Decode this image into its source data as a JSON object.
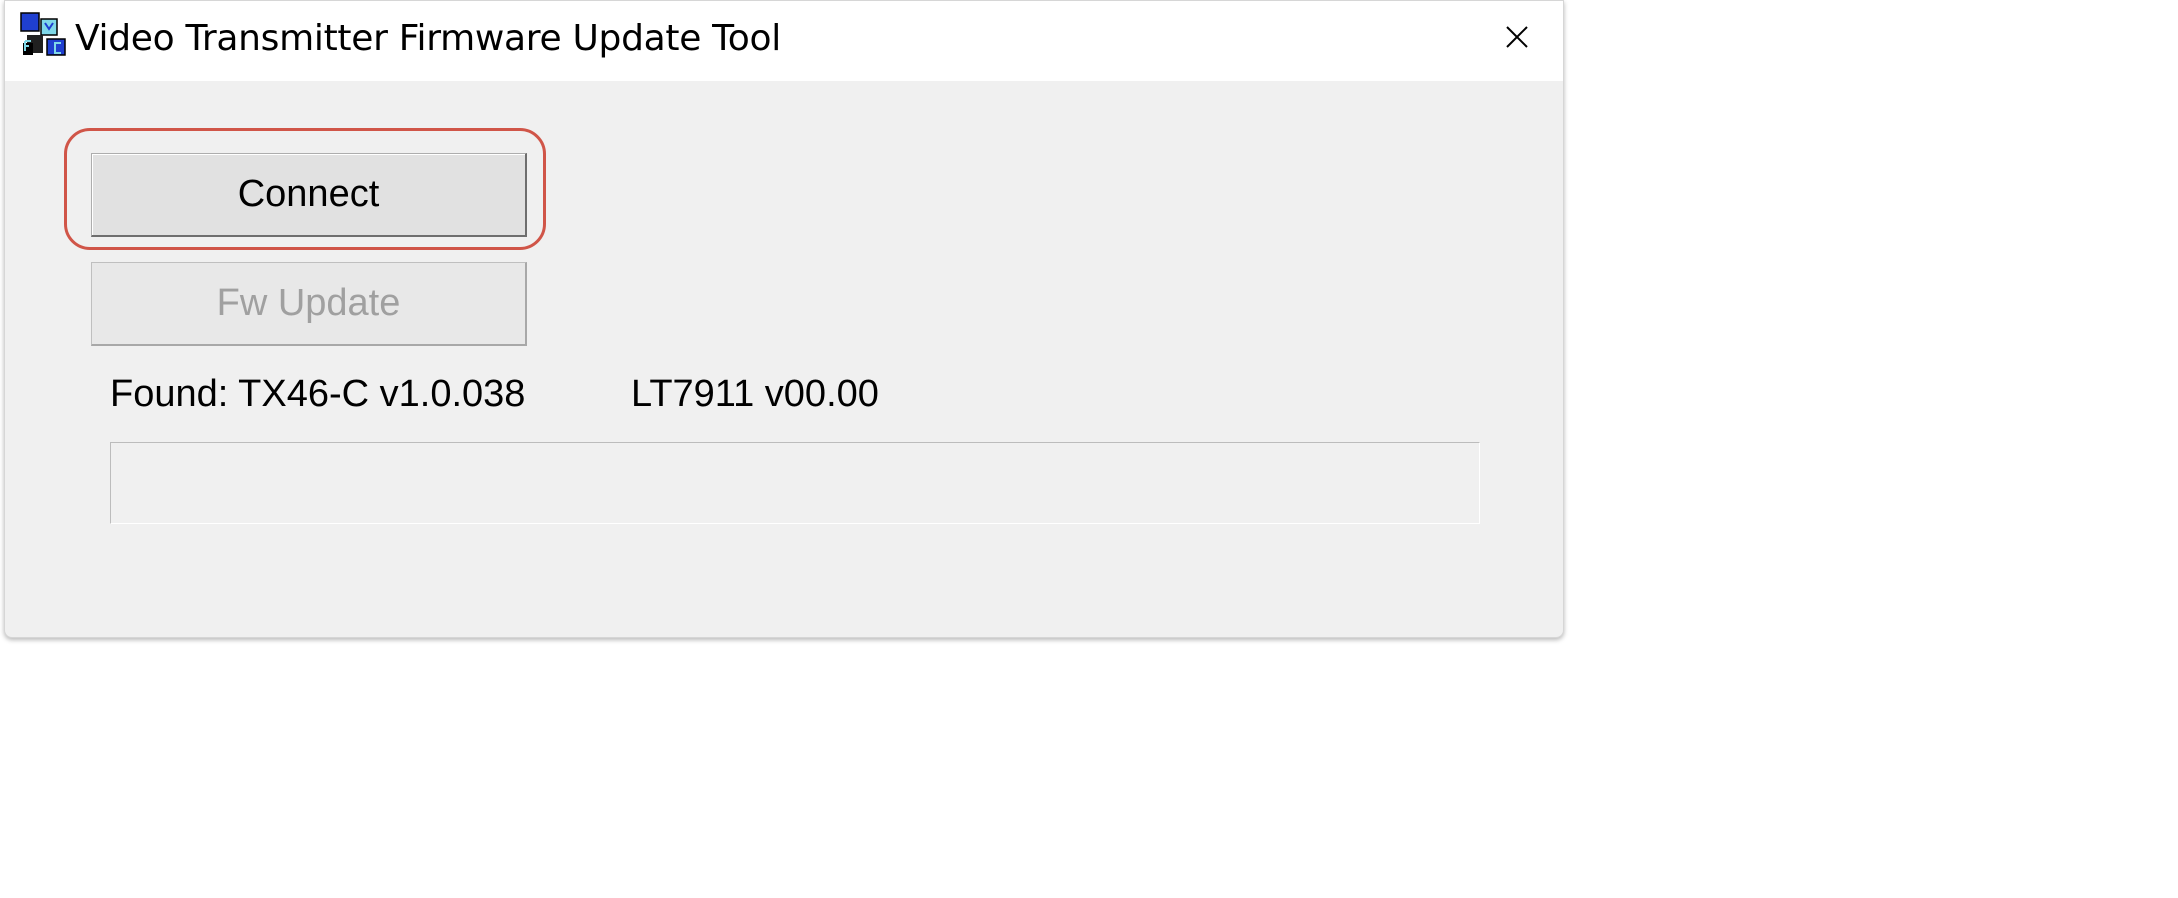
{
  "window": {
    "title": "Video Transmitter Firmware Update Tool",
    "icon": "mfc-app-icon",
    "close_icon": "close-icon",
    "close_glyph": "✕"
  },
  "buttons": {
    "connect_label": "Connect",
    "fw_update_label": "Fw Update",
    "fw_update_enabled": false
  },
  "status": {
    "found_text": "Found: TX46-C v1.0.038",
    "chip_text": "LT7911 v00.00"
  },
  "progress": {
    "value_percent": 0
  },
  "colors": {
    "highlight_ring": "#d05548",
    "disabled_text": "#a0a0a0",
    "window_bg": "#f0f0f0"
  }
}
